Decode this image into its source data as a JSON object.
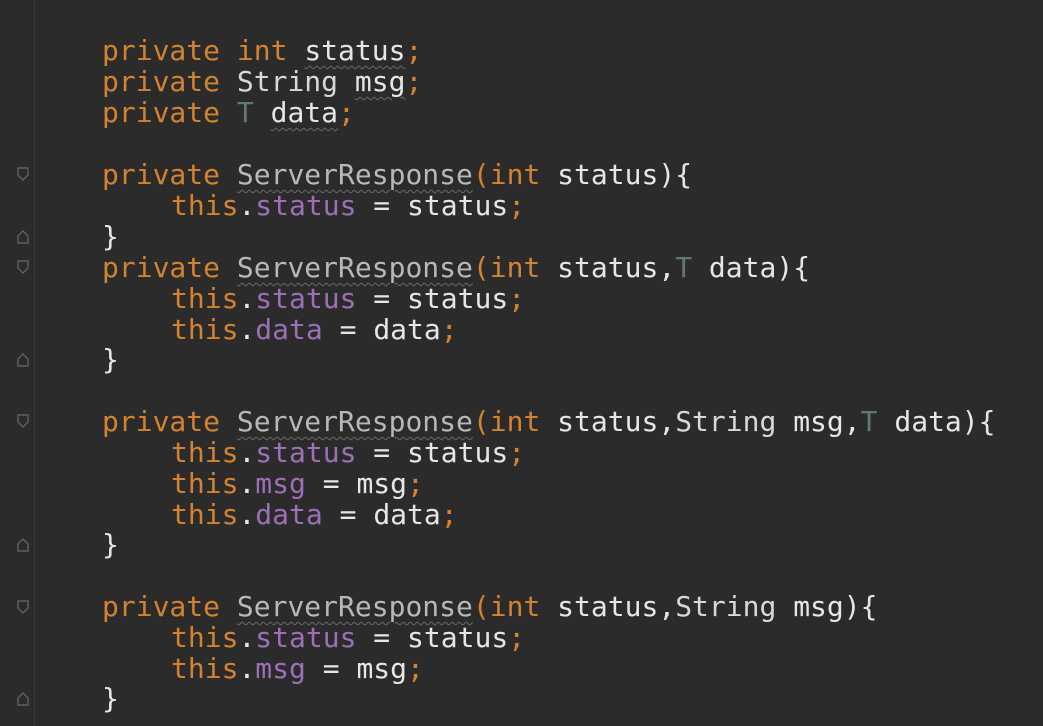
{
  "code": {
    "fields": [
      {
        "modifier": "private",
        "type": "int",
        "name": "status",
        "semi": ";"
      },
      {
        "modifier": "private",
        "type": "String",
        "name": "msg",
        "semi": ";"
      },
      {
        "modifier": "private",
        "type": "T",
        "name": "data",
        "semi": ";"
      }
    ],
    "ctor1": {
      "modifier": "private",
      "name": "ServerResponse",
      "open": "(",
      "p1_type": "int",
      "p1_name": " status",
      "close": "){",
      "body": [
        {
          "this": "this",
          "dot": ".",
          "field": "status",
          "assign": " = ",
          "value": "status",
          "semi": ";"
        }
      ],
      "end": "}"
    },
    "ctor2": {
      "modifier": "private",
      "name": "ServerResponse",
      "open": "(",
      "p1_type": "int",
      "p1_name": " status,",
      "p2_type": "T",
      "p2_name": " data",
      "close": "){",
      "body": [
        {
          "this": "this",
          "dot": ".",
          "field": "status",
          "assign": " = ",
          "value": "status",
          "semi": ";"
        },
        {
          "this": "this",
          "dot": ".",
          "field": "data",
          "assign": " = ",
          "value": "data",
          "semi": ";"
        }
      ],
      "end": "}"
    },
    "ctor3": {
      "modifier": "private",
      "name": "ServerResponse",
      "open": "(",
      "p1_type": "int",
      "p1_name": " status,",
      "p2_type": "String",
      "p2_name": " msg,",
      "p3_type": "T",
      "p3_name": " data",
      "close": "){",
      "body": [
        {
          "this": "this",
          "dot": ".",
          "field": "status",
          "assign": " = ",
          "value": "status",
          "semi": ";"
        },
        {
          "this": "this",
          "dot": ".",
          "field": "msg",
          "assign": " = ",
          "value": "msg",
          "semi": ";"
        },
        {
          "this": "this",
          "dot": ".",
          "field": "data",
          "assign": " = ",
          "value": "data",
          "semi": ";"
        }
      ],
      "end": "}"
    },
    "ctor4": {
      "modifier": "private",
      "name": "ServerResponse",
      "open": "(",
      "p1_type": "int",
      "p1_name": " status,",
      "p2_type": "String",
      "p2_name": " msg",
      "close": "){",
      "body": [
        {
          "this": "this",
          "dot": ".",
          "field": "status",
          "assign": " = ",
          "value": "status",
          "semi": ";"
        },
        {
          "this": "this",
          "dot": ".",
          "field": "msg",
          "assign": " = ",
          "value": "msg",
          "semi": ";"
        }
      ],
      "end": "}"
    }
  },
  "colors": {
    "background": "#2b2b2b",
    "keyword": "#d3822f",
    "field": "#9d6fb6",
    "generic": "#5f7a70",
    "text": "#e6e6e6"
  }
}
